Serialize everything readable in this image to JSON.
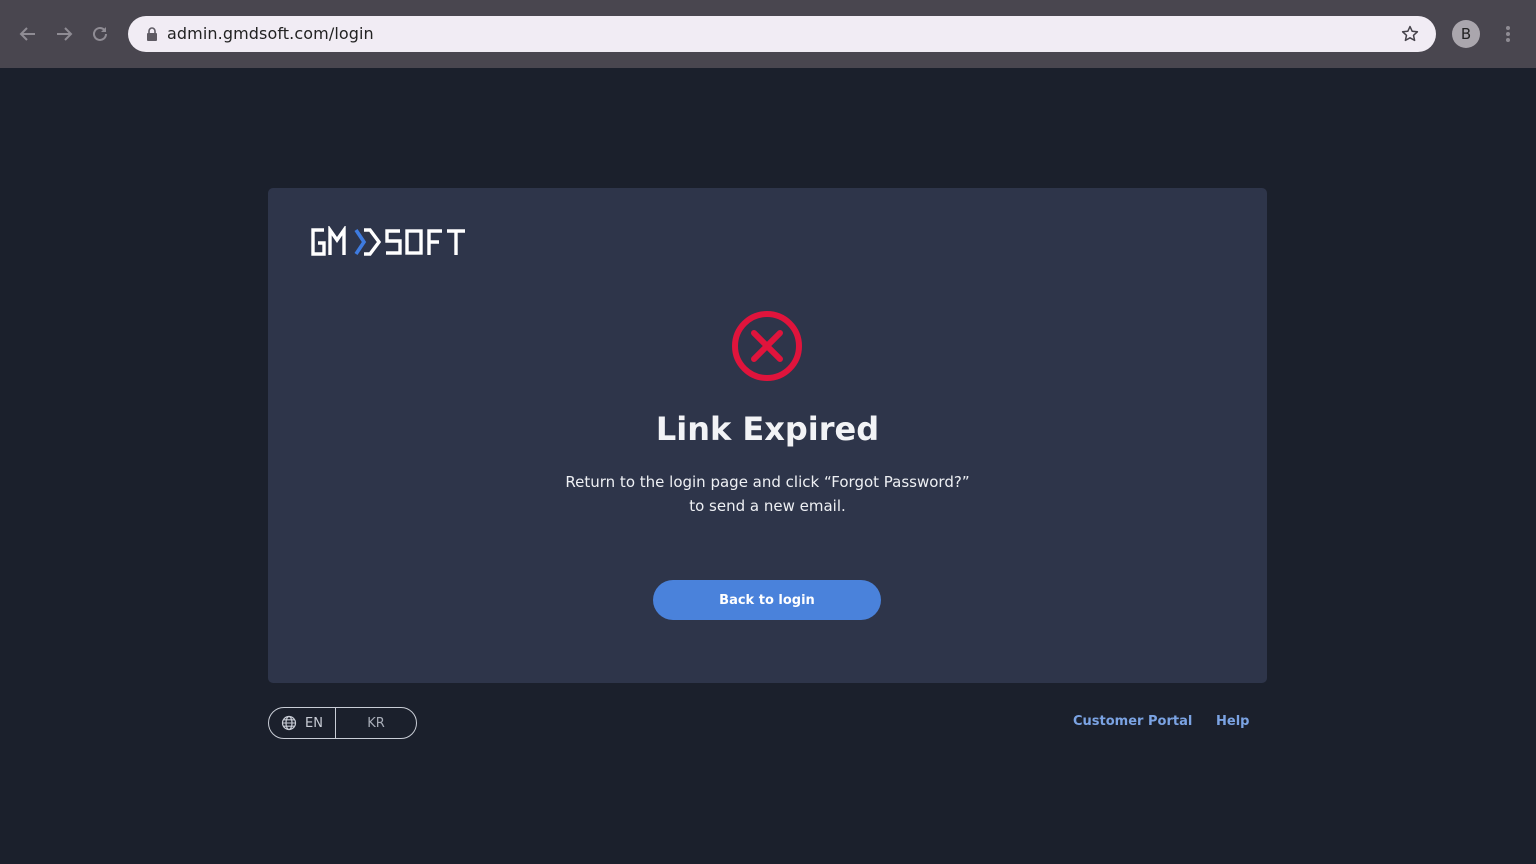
{
  "browser": {
    "url": "admin.gmdsoft.com/login",
    "profile_initial": "B"
  },
  "card": {
    "title": "Link Expired",
    "message_line1": "Return to the login page and click “Forgot Password?”",
    "message_line2": "to send a new email.",
    "back_button": "Back to login"
  },
  "footer": {
    "lang_en": "EN",
    "lang_kr": "KR",
    "customer_portal": "Customer Portal",
    "help": "Help"
  },
  "colors": {
    "background": "#1b202c",
    "card": "#2e354a",
    "accent": "#4a82db",
    "error": "#e0143c",
    "link": "#7ba3e3"
  },
  "icons": [
    "back-arrow-icon",
    "forward-arrow-icon",
    "reload-icon",
    "lock-icon",
    "star-icon",
    "kebab-menu-icon",
    "error-x-circle-icon",
    "globe-icon"
  ]
}
